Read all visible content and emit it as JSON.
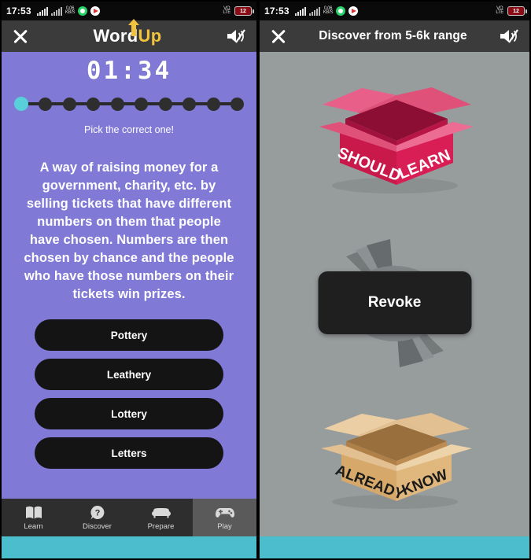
{
  "status_bar": {
    "time": "17:53",
    "battery_level": "12",
    "icons": [
      "signal-bars",
      "signal-bars-secondary",
      "network-speed",
      "whatsapp",
      "play-store",
      "vo-lte",
      "battery"
    ]
  },
  "left_screen": {
    "header": {
      "close_icon": "close-icon",
      "logo_first": "Word",
      "logo_second": "Up",
      "mute_icon": "speaker-mute-icon"
    },
    "timer": "01:34",
    "progress": {
      "total": 10,
      "current_index": 0
    },
    "hint": "Pick the correct one!",
    "definition": "A way of raising money for a government, charity, etc. by selling tickets that have different numbers on them that people have chosen. Numbers are then chosen by chance and the people who have those numbers on their tickets win prizes.",
    "options": [
      {
        "label": "Pottery"
      },
      {
        "label": "Leathery"
      },
      {
        "label": "Lottery"
      },
      {
        "label": "Letters"
      }
    ],
    "bottom_nav": [
      {
        "label": "Learn",
        "icon": "book-icon",
        "active": false
      },
      {
        "label": "Discover",
        "icon": "question-bubble-icon",
        "active": false
      },
      {
        "label": "Prepare",
        "icon": "sofa-icon",
        "active": false
      },
      {
        "label": "Play",
        "icon": "gamepad-icon",
        "active": true
      }
    ]
  },
  "right_screen": {
    "header": {
      "close_icon": "close-icon",
      "title": "Discover from 5-6k range",
      "mute_icon": "speaker-mute-icon"
    },
    "should_learn_box": {
      "text_left": "SHOULD",
      "text_right": "LEARN",
      "color": "#C9194B"
    },
    "word_card": {
      "word": "Revoke",
      "color": "#1f1f1f"
    },
    "already_know_box": {
      "text_left": "ALREADY",
      "text_right": "KNOW",
      "color": "#D6A96A"
    }
  },
  "colors": {
    "purple_background": "#8079D6",
    "gray_background": "#979C9D",
    "cyan_bar": "#4BBDCC",
    "accent_cyan": "#57D0D9",
    "header_dark": "#3B3B3B",
    "option_dark": "#141414",
    "logo_yellow": "#F2C43D"
  }
}
